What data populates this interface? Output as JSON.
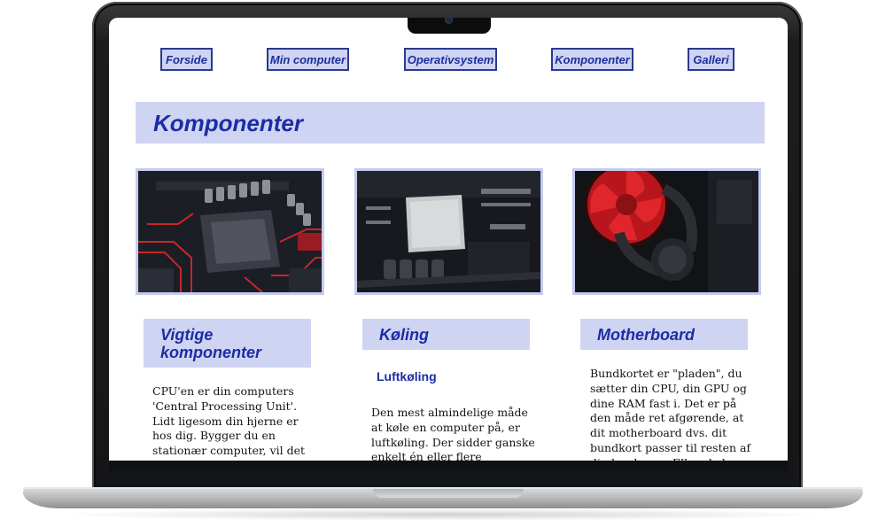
{
  "nav": {
    "items": [
      {
        "label": "Forside"
      },
      {
        "label": "Min computer"
      },
      {
        "label": "Operativsystem"
      },
      {
        "label": "Komponenter"
      },
      {
        "label": "Galleri"
      }
    ]
  },
  "page": {
    "title": "Komponenter"
  },
  "columns": [
    {
      "heading": "Vigtige komponenter",
      "text": "CPU'en er din computers 'Central Processing Unit'. Lidt ligesom din hjerne er hos dig. Bygger du en stationær computer, vil det første, du"
    },
    {
      "heading": "Køling",
      "subheading": "Luftkøling",
      "text": "Den mest almindelige måde at køle en computer på, er luftkøling. Der sidder ganske enkelt én eller flere"
    },
    {
      "heading": "Motherboard",
      "text": "Bundkortet er \"pladen\", du sætter din CPU, din GPU og dine RAM fast i. Det er på den måde ret afgørende, at dit motherboard dvs. dit bundkort passer til resten af din hardware. Eller skal man sige,"
    }
  ],
  "colors": {
    "accent": "#1c2da3",
    "panel": "#cfd4f3",
    "border": "#2a3a8f"
  },
  "icons": [
    "webcam-icon"
  ]
}
